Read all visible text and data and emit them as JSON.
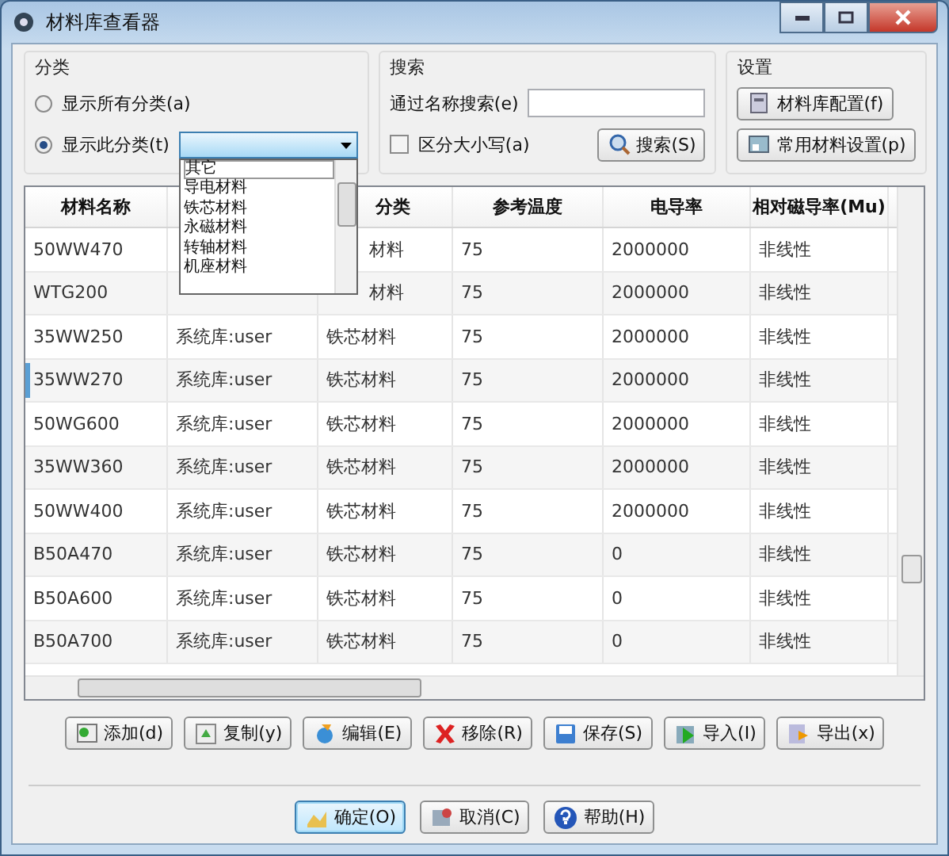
{
  "window": {
    "title": "材料库查看器"
  },
  "category_group": {
    "title": "分类",
    "options": [
      {
        "label": "显示所有分类(a)",
        "selected": false
      },
      {
        "label": "显示此分类(t)",
        "selected": true
      }
    ],
    "dropdown": {
      "expanded": true,
      "items": [
        {
          "label": "其它",
          "selected": true
        },
        {
          "label": "导电材料",
          "selected": false
        },
        {
          "label": "铁芯材料",
          "selected": false
        },
        {
          "label": "永磁材料",
          "selected": false
        },
        {
          "label": "转轴材料",
          "selected": false
        },
        {
          "label": "机座材料",
          "selected": false
        }
      ]
    }
  },
  "search_group": {
    "title": "搜索",
    "field_label": "通过名称搜索(e)",
    "case_sensitive": {
      "label": "区分大小写(a)",
      "checked": false
    },
    "search_button": "搜索(S)"
  },
  "settings_group": {
    "title": "设置",
    "buttons": [
      "材料库配置(f)",
      "常用材料设置(p)"
    ]
  },
  "table": {
    "columns": [
      "材料名称",
      null,
      "分类",
      "参考温度",
      "电导率",
      "相对磁导率(Mu)"
    ],
    "rows": [
      {
        "selected": false,
        "cells": [
          "50WW470",
          null,
          "材料",
          "75",
          "2000000",
          "非线性"
        ]
      },
      {
        "selected": false,
        "cells": [
          "WTG200",
          null,
          "材料",
          "75",
          "2000000",
          "非线性"
        ]
      },
      {
        "selected": false,
        "cells": [
          "35WW250",
          "系统库:user",
          "铁芯材料",
          "75",
          "2000000",
          "非线性"
        ]
      },
      {
        "selected": true,
        "cells": [
          "35WW270",
          "系统库:user",
          "铁芯材料",
          "75",
          "2000000",
          "非线性"
        ]
      },
      {
        "selected": false,
        "cells": [
          "50WG600",
          "系统库:user",
          "铁芯材料",
          "75",
          "2000000",
          "非线性"
        ]
      },
      {
        "selected": false,
        "cells": [
          "35WW360",
          "系统库:user",
          "铁芯材料",
          "75",
          "2000000",
          "非线性"
        ]
      },
      {
        "selected": false,
        "cells": [
          "50WW400",
          "系统库:user",
          "铁芯材料",
          "75",
          "2000000",
          "非线性"
        ]
      },
      {
        "selected": false,
        "cells": [
          "B50A470",
          "系统库:user",
          "铁芯材料",
          "75",
          "0",
          "非线性"
        ]
      },
      {
        "selected": false,
        "cells": [
          "B50A600",
          "系统库:user",
          "铁芯材料",
          "75",
          "0",
          "非线性"
        ]
      },
      {
        "selected": false,
        "cells": [
          "B50A700",
          "系统库:user",
          "铁芯材料",
          "75",
          "0",
          "非线性"
        ]
      }
    ]
  },
  "actions": [
    {
      "label": "添加(d)",
      "kind": "add"
    },
    {
      "label": "复制(y)",
      "kind": "copy"
    },
    {
      "label": "编辑(E)",
      "kind": "edit"
    },
    {
      "label": "移除(R)",
      "kind": "remove"
    },
    {
      "label": "保存(S)",
      "kind": "save"
    },
    {
      "label": "导入(I)",
      "kind": "import"
    },
    {
      "label": "导出(x)",
      "kind": "export"
    }
  ],
  "dialog_buttons": [
    {
      "label": "确定(O)",
      "kind": "ok",
      "selected": true
    },
    {
      "label": "取消(C)",
      "kind": "cancel",
      "selected": false
    },
    {
      "label": "帮助(H)",
      "kind": "help",
      "selected": false
    }
  ]
}
